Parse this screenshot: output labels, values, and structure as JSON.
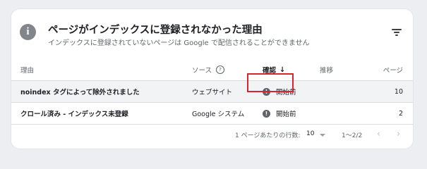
{
  "panel": {
    "info_icon": "info-icon",
    "title": "ページがインデックスに登録されなかった理由",
    "subtitle": "インデックスに登録されていないページは Google で配信されることができません",
    "filter_icon": "filter-list-icon"
  },
  "table": {
    "columns": {
      "reason": "理由",
      "source": "ソース",
      "status": "確認",
      "trend": "推移",
      "pages": "ページ"
    },
    "rows": [
      {
        "reason": "noindex タグによって除外されました",
        "source": "ウェブサイト",
        "status": "開始前",
        "pages": "10",
        "highlighted": true
      },
      {
        "reason": "クロール済み - インデックス未登録",
        "source": "Google システム",
        "status": "開始前",
        "pages": "2",
        "highlighted": false
      }
    ]
  },
  "pagination": {
    "rows_per_page_label": "1 ページあたりの行数:",
    "rows_per_page_value": "10",
    "range": "1〜2/2"
  },
  "colors": {
    "highlight_box": "#d9232d",
    "row_highlight": "#f1f3f4"
  }
}
